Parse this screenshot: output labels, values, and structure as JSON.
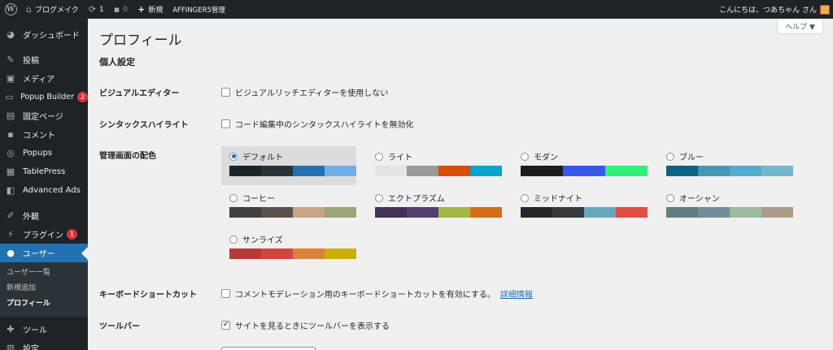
{
  "adminbar": {
    "site_name": "ブログメイク",
    "updates_count": "1",
    "comments_count": "0",
    "new_label": "新規",
    "affinger_label": "AFFINGER5管理",
    "greeting": "こんにちは、つあちゃん さん"
  },
  "sidebar": {
    "dashboard": "ダッシュボード",
    "posts": "投稿",
    "media": "メディア",
    "popup_builder": "Popup Builder",
    "popup_builder_badge": "2",
    "pages": "固定ページ",
    "comments": "コメント",
    "popups": "Popups",
    "tablepress": "TablePress",
    "advanced_ads": "Advanced Ads",
    "appearance": "外観",
    "plugins": "プラグイン",
    "plugins_badge": "1",
    "users": "ユーザー",
    "submenu": {
      "all_users": "ユーザー一覧",
      "add_new": "新規追加",
      "profile": "プロフィール"
    },
    "tools": "ツール",
    "settings": "設定"
  },
  "content": {
    "help_label": "ヘルプ ▼",
    "page_title": "プロフィール",
    "section_title": "個人設定",
    "visual_editor_label": "ビジュアルエディター",
    "visual_editor_option": "ビジュアルリッチエディターを使用しない",
    "syntax_label": "シンタックスハイライト",
    "syntax_option": "コード編集中のシンタックスハイライトを無効化",
    "color_scheme_label": "管理画面の配色",
    "color_schemes": [
      {
        "name": "デフォルト",
        "selected": true,
        "colors": [
          "#1d2327",
          "#2c3338",
          "#2271b1",
          "#72aee6"
        ]
      },
      {
        "name": "ライト",
        "selected": false,
        "colors": [
          "#e5e5e5",
          "#999999",
          "#d64e07",
          "#04a4cc"
        ]
      },
      {
        "name": "モダン",
        "selected": false,
        "colors": [
          "#1e1e1e",
          "#3858e9",
          "#33f078"
        ]
      },
      {
        "name": "ブルー",
        "selected": false,
        "colors": [
          "#096484",
          "#4796b3",
          "#52accc",
          "#74b6ce"
        ]
      },
      {
        "name": "コーヒー",
        "selected": false,
        "colors": [
          "#46403c",
          "#59524c",
          "#c7a589",
          "#9ea476"
        ]
      },
      {
        "name": "エクトプラズム",
        "selected": false,
        "colors": [
          "#413256",
          "#523f6d",
          "#a3b745",
          "#d46f15"
        ]
      },
      {
        "name": "ミッドナイト",
        "selected": false,
        "colors": [
          "#25282b",
          "#363b3f",
          "#69a8bb",
          "#e14d43"
        ]
      },
      {
        "name": "オーシャン",
        "selected": false,
        "colors": [
          "#627c83",
          "#738e96",
          "#9ebaa0",
          "#aa9d88"
        ]
      },
      {
        "name": "サンライズ",
        "selected": false,
        "colors": [
          "#b43c38",
          "#cf4944",
          "#dd823b",
          "#ccaf0b"
        ]
      }
    ],
    "keyboard_label": "キーボードショートカット",
    "keyboard_option": "コメントモデレーション用のキーボードショートカットを有効にする。",
    "keyboard_link": "詳細情報",
    "toolbar_label": "ツールバー",
    "toolbar_option": "サイトを見るときにツールバーを表示する",
    "toolbar_checked": true
  }
}
